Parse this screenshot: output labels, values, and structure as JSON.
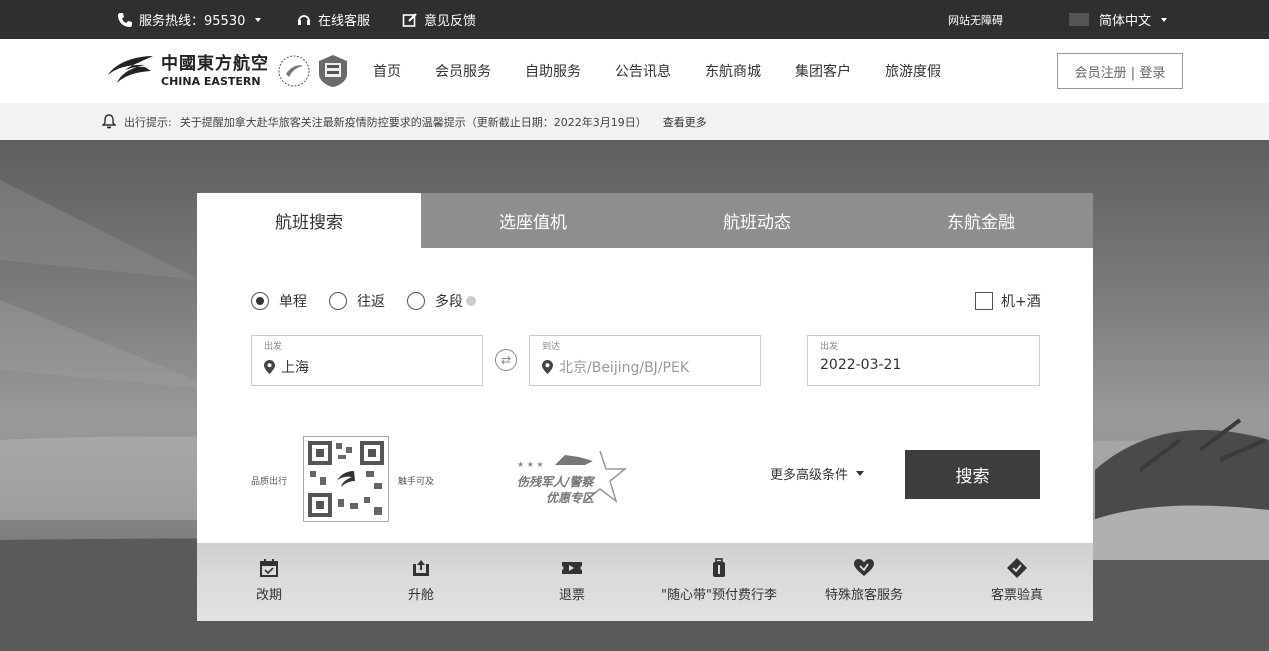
{
  "topbar": {
    "hotline": "服务热线：95530",
    "online_service": "在线客服",
    "feedback": "意见反馈",
    "accessibility": "网站无障碍",
    "language": "简体中文"
  },
  "nav": {
    "logo_cn": "中國東方航空",
    "logo_en": "CHINA EASTERN",
    "links": [
      "首页",
      "会员服务",
      "自助服务",
      "公告讯息",
      "东航商城",
      "集团客户",
      "旅游度假"
    ],
    "login": "会员注册 | 登录"
  },
  "notice": {
    "tag": "出行提示:",
    "text": "关于提醒加拿大赴华旅客关注最新疫情防控要求的温馨提示（更新截止日期：2022年3月19日）",
    "more": "查看更多"
  },
  "search": {
    "tabs": [
      "航班搜索",
      "选座值机",
      "航班动态",
      "东航金融"
    ],
    "trip_types": [
      "单程",
      "往返",
      "多段"
    ],
    "combo": "机+酒",
    "origin_label": "出发",
    "origin_value": "上海",
    "dest_label": "到达",
    "dest_placeholder": "北京/Beijing/BJ/PEK",
    "date_label": "出发",
    "date_value": "2022-03-21",
    "qr_left": "品质出行",
    "qr_right": "触手可及",
    "military_line1": "伤残军人/警察",
    "military_line2": "优惠专区",
    "advanced": "更多高级条件",
    "search_btn": "搜索"
  },
  "services": [
    "改期",
    "升舱",
    "退票",
    "\"随心带\"预付费行李",
    "特殊旅客服务",
    "客票验真"
  ]
}
